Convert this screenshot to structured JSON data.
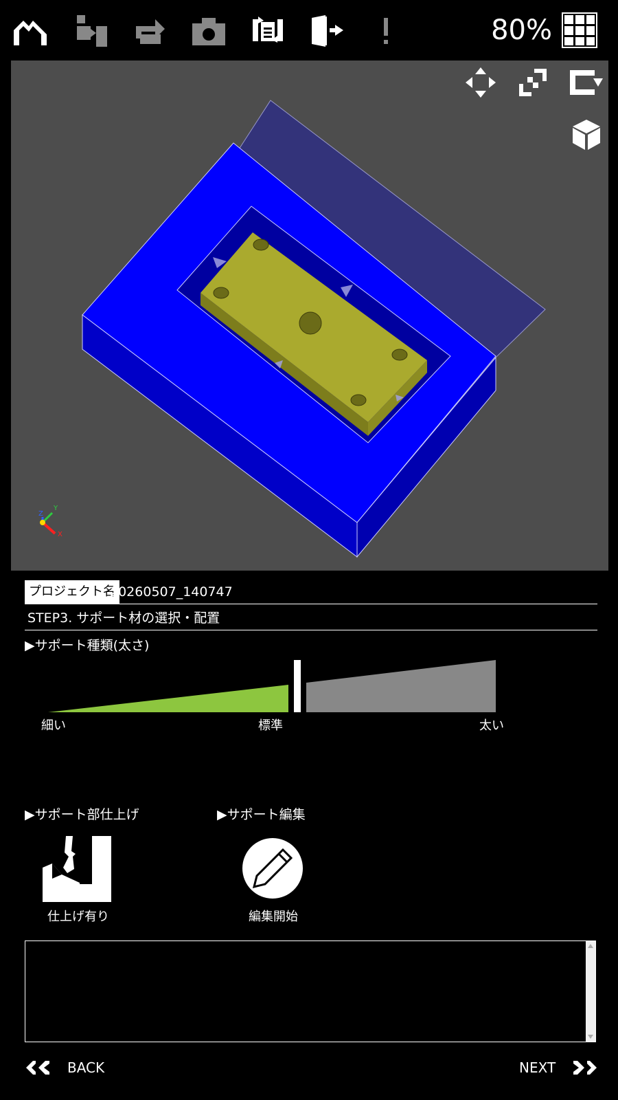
{
  "toolbar": {
    "icons": [
      "mountain-icon",
      "move-part-icon",
      "rotate-part-icon",
      "camera-icon",
      "refresh-document-icon",
      "exit-door-icon",
      "alert-icon",
      "grid-icon"
    ],
    "zoom": "80%"
  },
  "viewport": {
    "controls": [
      "pan-icon",
      "fit-view-icon",
      "rotate-view-icon",
      "cube-view-icon"
    ],
    "axes": [
      "X",
      "Y",
      "Z"
    ],
    "colors": {
      "background": "#4d4d4d",
      "support": "#0000ff",
      "part": "#aaaa2e"
    }
  },
  "project": {
    "label": "プロジェクト名",
    "name": "20260507_140747"
  },
  "step": "STEP3. サポート材の選択・配置",
  "support_type": {
    "title": "▶サポート種類(太さ)",
    "labels": {
      "thin": "細い",
      "standard": "標準",
      "thick": "太い"
    },
    "level": 0.55,
    "colors": {
      "selected": "#8dc63f",
      "unselected": "#888888"
    }
  },
  "finish": {
    "title": "▶サポート部仕上げ",
    "caption": "仕上げ有り"
  },
  "edit": {
    "title": "▶サポート編集",
    "caption": "編集開始"
  },
  "message": "",
  "nav": {
    "back": "BACK",
    "next": "NEXT"
  }
}
